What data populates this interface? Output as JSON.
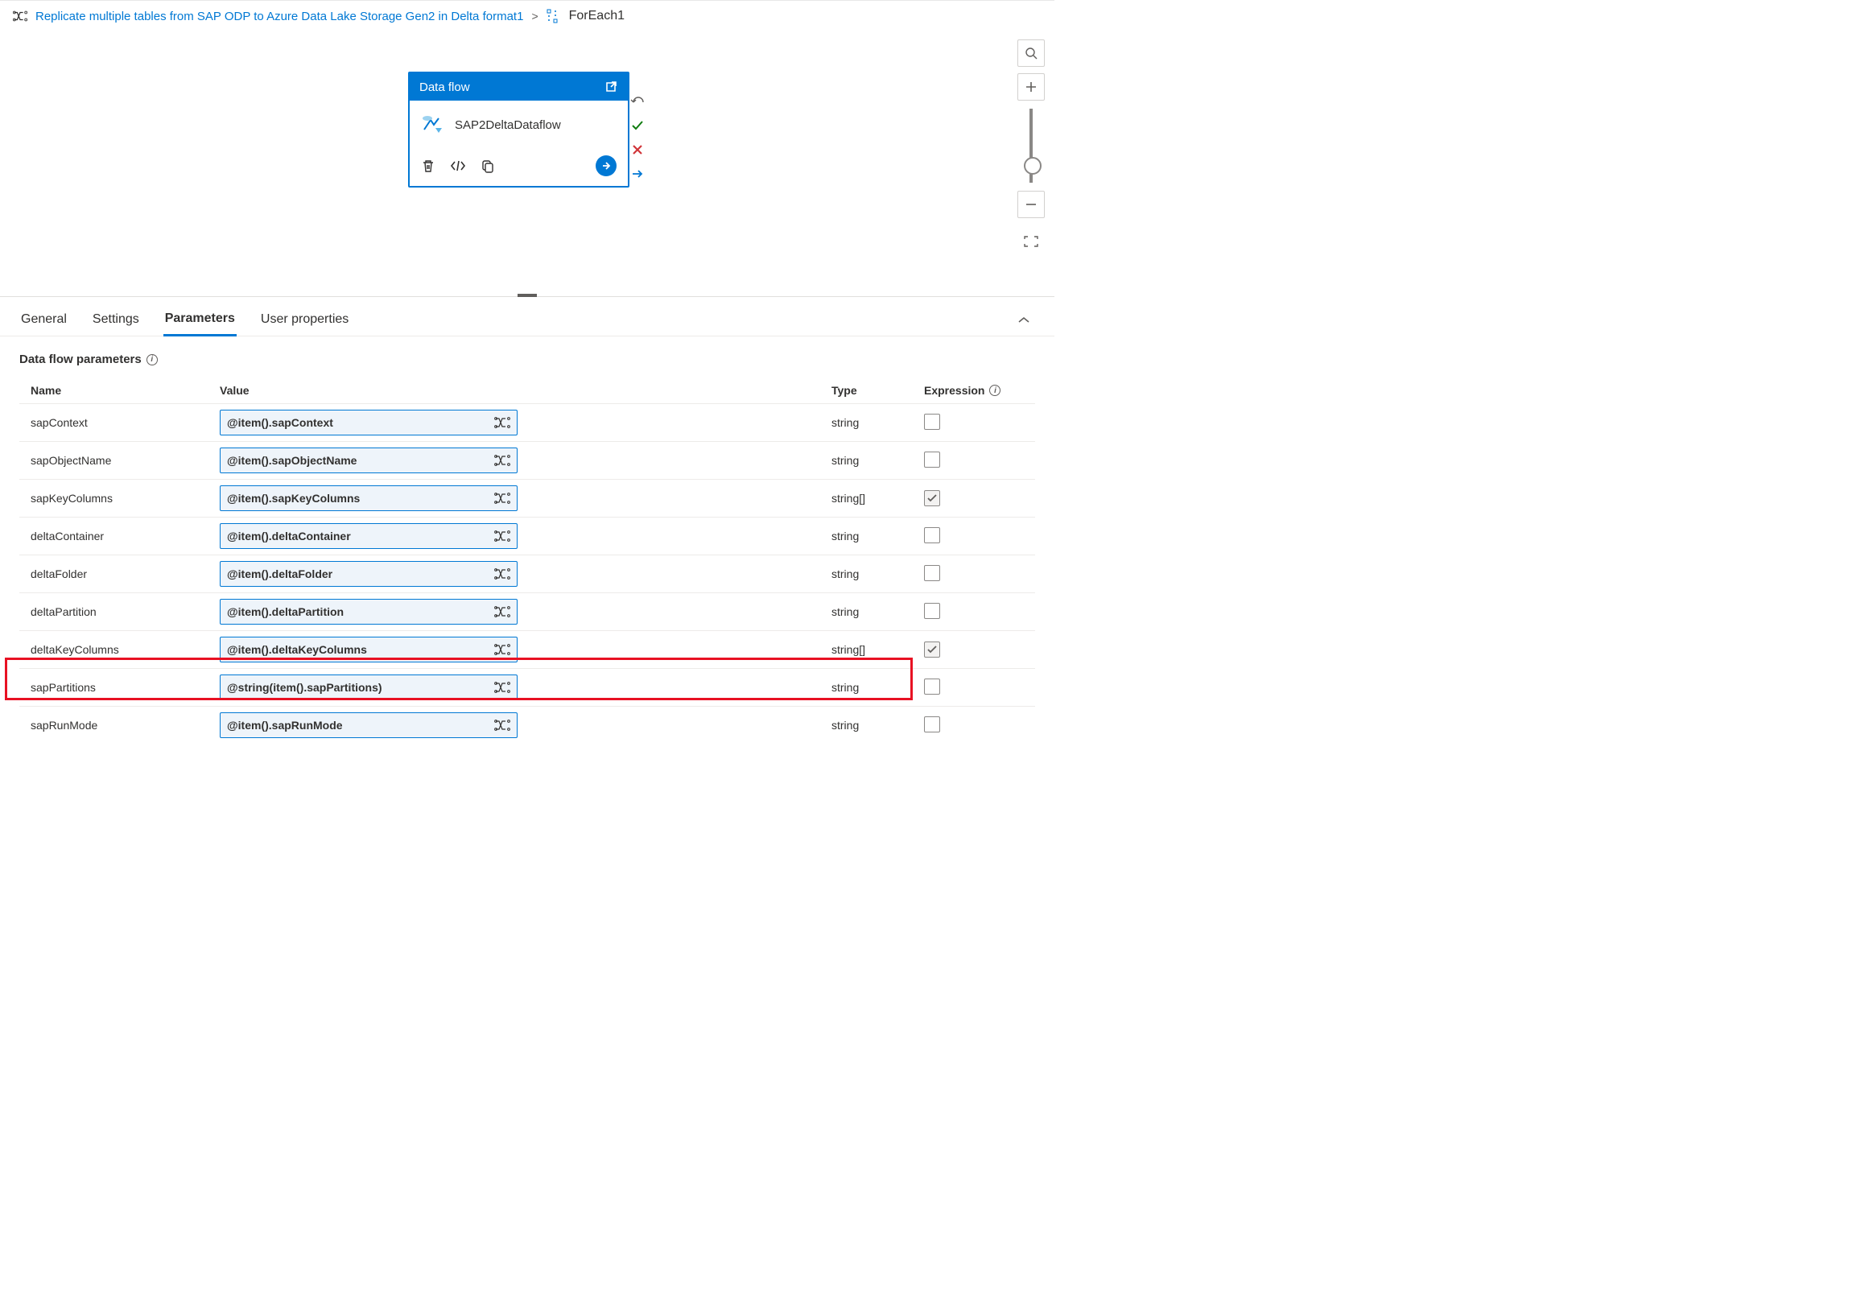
{
  "breadcrumb": {
    "pipeline_link": "Replicate multiple tables from SAP ODP to Azure Data Lake Storage Gen2 in Delta format1",
    "current": "ForEach1"
  },
  "activity": {
    "header": "Data flow",
    "name": "SAP2DeltaDataflow"
  },
  "tabs": {
    "general": "General",
    "settings": "Settings",
    "parameters": "Parameters",
    "user_properties": "User properties"
  },
  "section": {
    "title": "Data flow parameters"
  },
  "cols": {
    "name": "Name",
    "value": "Value",
    "type": "Type",
    "expression": "Expression"
  },
  "params": [
    {
      "name": "sapContext",
      "value": "@item().sapContext",
      "type": "string",
      "checked": false
    },
    {
      "name": "sapObjectName",
      "value": "@item().sapObjectName",
      "type": "string",
      "checked": false
    },
    {
      "name": "sapKeyColumns",
      "value": "@item().sapKeyColumns",
      "type": "string[]",
      "checked": true
    },
    {
      "name": "deltaContainer",
      "value": "@item().deltaContainer",
      "type": "string",
      "checked": false
    },
    {
      "name": "deltaFolder",
      "value": "@item().deltaFolder",
      "type": "string",
      "checked": false
    },
    {
      "name": "deltaPartition",
      "value": "@item().deltaPartition",
      "type": "string",
      "checked": false
    },
    {
      "name": "deltaKeyColumns",
      "value": "@item().deltaKeyColumns",
      "type": "string[]",
      "checked": true
    },
    {
      "name": "sapPartitions",
      "value": "@string(item().sapPartitions)",
      "type": "string",
      "checked": false
    },
    {
      "name": "sapRunMode",
      "value": "@item().sapRunMode",
      "type": "string",
      "checked": false
    }
  ]
}
